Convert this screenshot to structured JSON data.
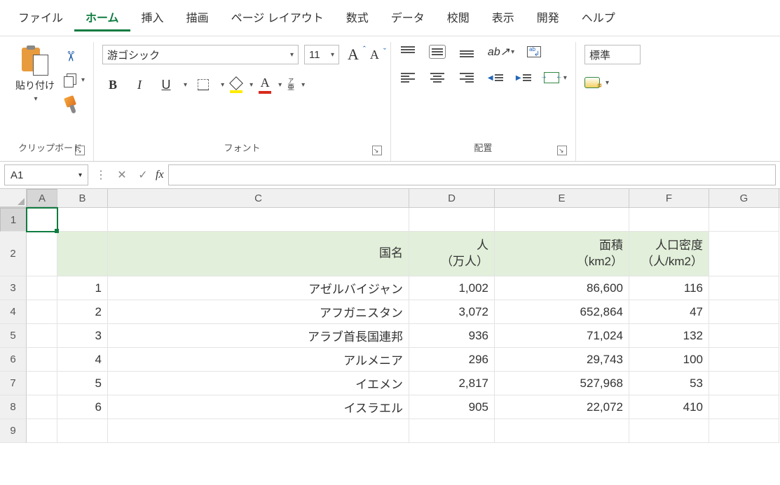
{
  "menu": [
    "ファイル",
    "ホーム",
    "挿入",
    "描画",
    "ページ レイアウト",
    "数式",
    "データ",
    "校閲",
    "表示",
    "開発",
    "ヘルプ"
  ],
  "menu_active": 1,
  "ribbon": {
    "clipboard": {
      "paste": "貼り付け",
      "label": "クリップボード"
    },
    "font": {
      "name": "游ゴシック",
      "size": "11",
      "label": "フォント",
      "buttons": {
        "bold": "B",
        "italic": "I",
        "underline": "U",
        "fontcolor": "A"
      },
      "ruby_top": "ア",
      "ruby_bottom": "亜"
    },
    "align": {
      "label": "配置"
    },
    "number": {
      "format": "標準"
    }
  },
  "namebox": "A1",
  "formula": "",
  "columns": [
    "A",
    "B",
    "C",
    "D",
    "E",
    "F",
    "G"
  ],
  "header_row": {
    "C": "国名",
    "D": "人\n（万人）",
    "E": "面積\n（km2）",
    "F": "人口密度\n（人/km2）"
  },
  "rows": [
    {
      "n": "1",
      "country": "アゼルバイジャン",
      "pop": "1,002",
      "area": "86,600",
      "density": "116"
    },
    {
      "n": "2",
      "country": "アフガニスタン",
      "pop": "3,072",
      "area": "652,864",
      "density": "47"
    },
    {
      "n": "3",
      "country": "アラブ首長国連邦",
      "pop": "936",
      "area": "71,024",
      "density": "132"
    },
    {
      "n": "4",
      "country": "アルメニア",
      "pop": "296",
      "area": "29,743",
      "density": "100"
    },
    {
      "n": "5",
      "country": "イエメン",
      "pop": "2,817",
      "area": "527,968",
      "density": "53"
    },
    {
      "n": "6",
      "country": "イスラエル",
      "pop": "905",
      "area": "22,072",
      "density": "410"
    }
  ],
  "row_heights": {
    "normal": 34,
    "header": 64
  }
}
